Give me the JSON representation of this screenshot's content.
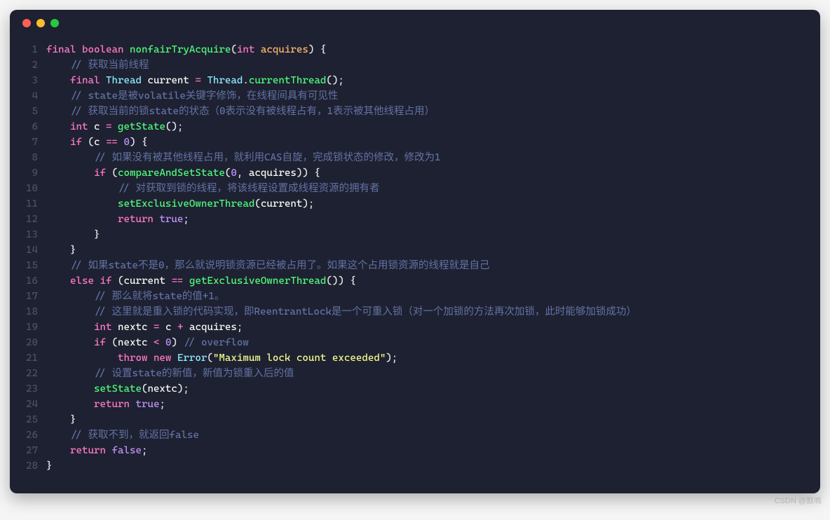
{
  "watermark": "CSDN @默鳴",
  "lines": [
    {
      "n": "1",
      "tokens": [
        [
          "kw",
          "final"
        ],
        [
          "pn",
          " "
        ],
        [
          "kw",
          "boolean"
        ],
        [
          "pn",
          " "
        ],
        [
          "fn",
          "nonfairTryAcquire"
        ],
        [
          "pn",
          "("
        ],
        [
          "kw",
          "int"
        ],
        [
          "pn",
          " "
        ],
        [
          "param",
          "acquires"
        ],
        [
          "pn",
          ") {"
        ]
      ]
    },
    {
      "n": "2",
      "tokens": [
        [
          "pn",
          "    "
        ],
        [
          "cmt",
          "// 获取当前线程"
        ]
      ]
    },
    {
      "n": "3",
      "tokens": [
        [
          "pn",
          "    "
        ],
        [
          "kw",
          "final"
        ],
        [
          "pn",
          " "
        ],
        [
          "type",
          "Thread"
        ],
        [
          "pn",
          " "
        ],
        [
          "var",
          "current"
        ],
        [
          "pn",
          " "
        ],
        [
          "op",
          "="
        ],
        [
          "pn",
          " "
        ],
        [
          "type",
          "Thread"
        ],
        [
          "pn",
          "."
        ],
        [
          "fn",
          "currentThread"
        ],
        [
          "pn",
          "();"
        ]
      ]
    },
    {
      "n": "4",
      "tokens": [
        [
          "pn",
          "    "
        ],
        [
          "cmt",
          "// state是被volatile关键字修饰，在线程间具有可见性"
        ]
      ]
    },
    {
      "n": "5",
      "tokens": [
        [
          "pn",
          "    "
        ],
        [
          "cmt",
          "// 获取当前的锁state的状态（0表示没有被线程占有，1表示被其他线程占用）"
        ]
      ]
    },
    {
      "n": "6",
      "tokens": [
        [
          "pn",
          "    "
        ],
        [
          "kw",
          "int"
        ],
        [
          "pn",
          " "
        ],
        [
          "var",
          "c"
        ],
        [
          "pn",
          " "
        ],
        [
          "op",
          "="
        ],
        [
          "pn",
          " "
        ],
        [
          "fn",
          "getState"
        ],
        [
          "pn",
          "();"
        ]
      ]
    },
    {
      "n": "7",
      "tokens": [
        [
          "pn",
          "    "
        ],
        [
          "kw",
          "if"
        ],
        [
          "pn",
          " ("
        ],
        [
          "var",
          "c"
        ],
        [
          "pn",
          " "
        ],
        [
          "op",
          "=="
        ],
        [
          "pn",
          " "
        ],
        [
          "num",
          "0"
        ],
        [
          "pn",
          ") {"
        ]
      ]
    },
    {
      "n": "8",
      "tokens": [
        [
          "pn",
          "        "
        ],
        [
          "cmt",
          "// 如果没有被其他线程占用，就利用CAS自旋，完成锁状态的修改，修改为1"
        ]
      ]
    },
    {
      "n": "9",
      "tokens": [
        [
          "pn",
          "        "
        ],
        [
          "kw",
          "if"
        ],
        [
          "pn",
          " ("
        ],
        [
          "fn",
          "compareAndSetState"
        ],
        [
          "pn",
          "("
        ],
        [
          "num",
          "0"
        ],
        [
          "pn",
          ", "
        ],
        [
          "var",
          "acquires"
        ],
        [
          "pn",
          ")) {"
        ]
      ]
    },
    {
      "n": "10",
      "tokens": [
        [
          "pn",
          "            "
        ],
        [
          "cmt",
          "// 对获取到锁的线程，将该线程设置成线程资源的拥有者"
        ]
      ]
    },
    {
      "n": "11",
      "tokens": [
        [
          "pn",
          "            "
        ],
        [
          "fn",
          "setExclusiveOwnerThread"
        ],
        [
          "pn",
          "("
        ],
        [
          "var",
          "current"
        ],
        [
          "pn",
          ");"
        ]
      ]
    },
    {
      "n": "12",
      "tokens": [
        [
          "pn",
          "            "
        ],
        [
          "kw",
          "return"
        ],
        [
          "pn",
          " "
        ],
        [
          "bool",
          "true"
        ],
        [
          "pn",
          ";"
        ]
      ]
    },
    {
      "n": "13",
      "tokens": [
        [
          "pn",
          "        }"
        ]
      ]
    },
    {
      "n": "14",
      "tokens": [
        [
          "pn",
          "    }"
        ]
      ]
    },
    {
      "n": "15",
      "tokens": [
        [
          "pn",
          "    "
        ],
        [
          "cmt",
          "// 如果state不是0，那么就说明锁资源已经被占用了。如果这个占用锁资源的线程就是自己"
        ]
      ]
    },
    {
      "n": "16",
      "tokens": [
        [
          "pn",
          "    "
        ],
        [
          "kw",
          "else"
        ],
        [
          "pn",
          " "
        ],
        [
          "kw",
          "if"
        ],
        [
          "pn",
          " ("
        ],
        [
          "var",
          "current"
        ],
        [
          "pn",
          " "
        ],
        [
          "op",
          "=="
        ],
        [
          "pn",
          " "
        ],
        [
          "fn",
          "getExclusiveOwnerThread"
        ],
        [
          "pn",
          "()) {"
        ]
      ]
    },
    {
      "n": "17",
      "tokens": [
        [
          "pn",
          "        "
        ],
        [
          "cmt",
          "// 那么就将state的值+1。"
        ]
      ]
    },
    {
      "n": "18",
      "tokens": [
        [
          "pn",
          "        "
        ],
        [
          "cmt",
          "// 这里就是重入锁的代码实现，即ReentrantLock是一个可重入锁（对一个加锁的方法再次加锁，此时能够加锁成功）"
        ]
      ]
    },
    {
      "n": "19",
      "tokens": [
        [
          "pn",
          "        "
        ],
        [
          "kw",
          "int"
        ],
        [
          "pn",
          " "
        ],
        [
          "var",
          "nextc"
        ],
        [
          "pn",
          " "
        ],
        [
          "op",
          "="
        ],
        [
          "pn",
          " "
        ],
        [
          "var",
          "c"
        ],
        [
          "pn",
          " "
        ],
        [
          "op",
          "+"
        ],
        [
          "pn",
          " "
        ],
        [
          "var",
          "acquires"
        ],
        [
          "pn",
          ";"
        ]
      ]
    },
    {
      "n": "20",
      "tokens": [
        [
          "pn",
          "        "
        ],
        [
          "kw",
          "if"
        ],
        [
          "pn",
          " ("
        ],
        [
          "var",
          "nextc"
        ],
        [
          "pn",
          " "
        ],
        [
          "op",
          "<"
        ],
        [
          "pn",
          " "
        ],
        [
          "num",
          "0"
        ],
        [
          "pn",
          ") "
        ],
        [
          "cmt",
          "// overflow"
        ]
      ]
    },
    {
      "n": "21",
      "tokens": [
        [
          "pn",
          "            "
        ],
        [
          "kw",
          "throw"
        ],
        [
          "pn",
          " "
        ],
        [
          "kw",
          "new"
        ],
        [
          "pn",
          " "
        ],
        [
          "type",
          "Error"
        ],
        [
          "pn",
          "("
        ],
        [
          "str",
          "\"Maximum lock count exceeded\""
        ],
        [
          "pn",
          ");"
        ]
      ]
    },
    {
      "n": "22",
      "tokens": [
        [
          "pn",
          "        "
        ],
        [
          "cmt",
          "// 设置state的新值，新值为锁重入后的值"
        ]
      ]
    },
    {
      "n": "23",
      "tokens": [
        [
          "pn",
          "        "
        ],
        [
          "fn",
          "setState"
        ],
        [
          "pn",
          "("
        ],
        [
          "var",
          "nextc"
        ],
        [
          "pn",
          ");"
        ]
      ]
    },
    {
      "n": "24",
      "tokens": [
        [
          "pn",
          "        "
        ],
        [
          "kw",
          "return"
        ],
        [
          "pn",
          " "
        ],
        [
          "bool",
          "true"
        ],
        [
          "pn",
          ";"
        ]
      ]
    },
    {
      "n": "25",
      "tokens": [
        [
          "pn",
          "    }"
        ]
      ]
    },
    {
      "n": "26",
      "tokens": [
        [
          "pn",
          "    "
        ],
        [
          "cmt",
          "// 获取不到，就返回false"
        ]
      ]
    },
    {
      "n": "27",
      "tokens": [
        [
          "pn",
          "    "
        ],
        [
          "kw",
          "return"
        ],
        [
          "pn",
          " "
        ],
        [
          "bool",
          "false"
        ],
        [
          "pn",
          ";"
        ]
      ]
    },
    {
      "n": "28",
      "tokens": [
        [
          "pn",
          "}"
        ]
      ]
    }
  ]
}
